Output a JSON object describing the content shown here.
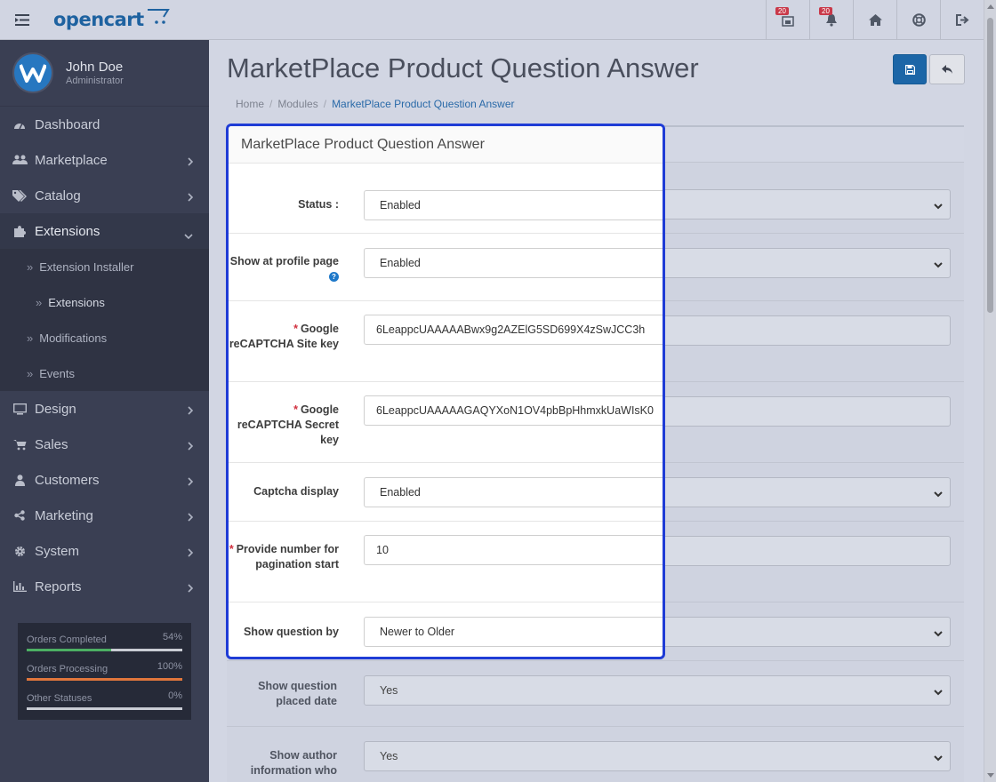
{
  "header": {
    "logo_text": "opencart",
    "badges": [
      "20",
      "20"
    ]
  },
  "sidebar": {
    "profile": {
      "name": "John Doe",
      "role": "Administrator"
    },
    "items": [
      {
        "label": "Dashboard",
        "icon": "dashboard-icon"
      },
      {
        "label": "Marketplace",
        "icon": "users-icon"
      },
      {
        "label": "Catalog",
        "icon": "tags-icon"
      },
      {
        "label": "Extensions",
        "icon": "puzzle-icon"
      },
      {
        "label": "Design",
        "icon": "monitor-icon"
      },
      {
        "label": "Sales",
        "icon": "cart-icon"
      },
      {
        "label": "Customers",
        "icon": "user-icon"
      },
      {
        "label": "Marketing",
        "icon": "share-icon"
      },
      {
        "label": "System",
        "icon": "cog-icon"
      },
      {
        "label": "Reports",
        "icon": "bar-chart-icon"
      }
    ],
    "subitems": [
      "Extension Installer",
      "Extensions",
      "Modifications",
      "Events"
    ],
    "stats": [
      {
        "label": "Orders Completed",
        "pct": "54%",
        "value": 54,
        "color": "#4caf63"
      },
      {
        "label": "Orders Processing",
        "pct": "100%",
        "value": 100,
        "color": "#e0763c"
      },
      {
        "label": "Other Statuses",
        "pct": "0%",
        "value": 0,
        "color": "#c9ccd4"
      }
    ]
  },
  "page": {
    "title": "MarketPlace Product Question Answer",
    "breadcrumb": [
      "Home",
      "Modules",
      "MarketPlace Product Question Answer"
    ]
  },
  "form": {
    "panel_title": "MarketPlace Product Question Answer",
    "status": {
      "label": "Status :",
      "value": "Enabled"
    },
    "profile": {
      "label": "Show at profile page",
      "value": "Enabled"
    },
    "site_key": {
      "label": "Google reCAPTCHA Site key",
      "value": "6LeappcUAAAAABwx9g2AZElG5SD699X4zSwJCC3h"
    },
    "secret_key": {
      "label": "Google reCAPTCHA Secret key",
      "value": "6LeappcUAAAAAGAQYXoN1OV4pbBpHhmxkUaWIsK0"
    },
    "captcha": {
      "label": "Captcha display",
      "value": "Enabled"
    },
    "pagination": {
      "label": "Provide number for pagination start",
      "value": "10"
    },
    "order": {
      "label": "Show question by",
      "value": "Newer to Older"
    },
    "date": {
      "label": "Show question placed date",
      "value": "Yes"
    },
    "author": {
      "label": "Show author information who",
      "value": "Yes"
    }
  }
}
